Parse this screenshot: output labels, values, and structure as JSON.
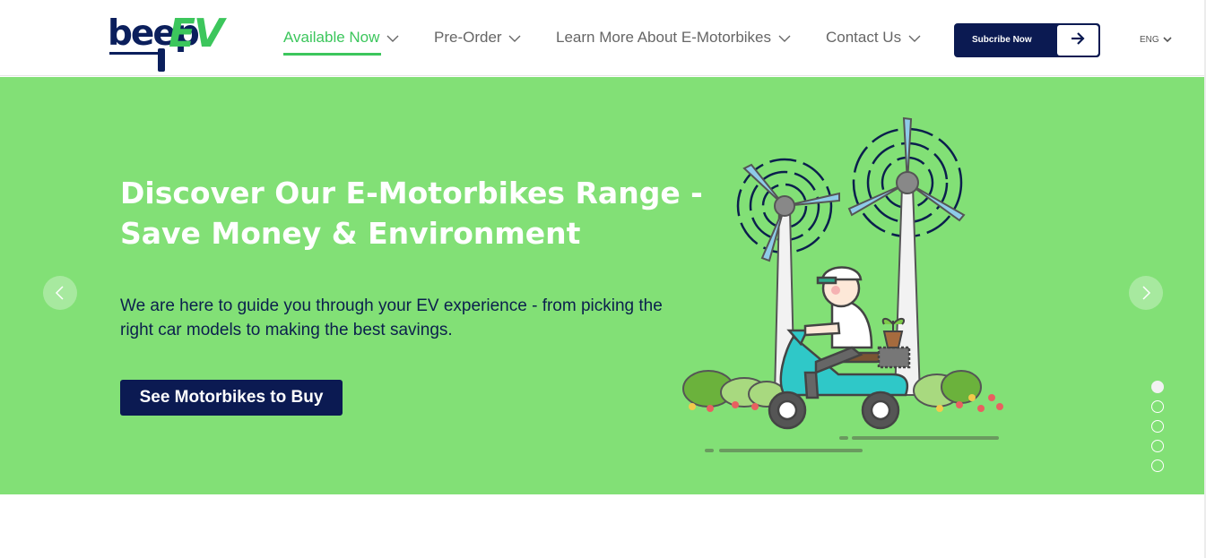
{
  "brand": {
    "logo_text_1": "beep",
    "logo_text_2": "EV"
  },
  "nav": {
    "items": [
      {
        "label": "Available Now",
        "active": true
      },
      {
        "label": "Pre-Order",
        "active": false
      },
      {
        "label": "Learn More About E-Motorbikes",
        "active": false
      },
      {
        "label": "Contact Us",
        "active": false
      }
    ]
  },
  "subscribe": {
    "label": "Subcribe Now",
    "icon": "arrow-right-icon"
  },
  "language": {
    "label": "ENG",
    "icon": "chevron-down-icon"
  },
  "hero": {
    "title": "Discover Our E-Motorbikes Range - Save Money & Environment",
    "subtitle": "We are here to guide you through your EV experience - from picking the right car models to making the best savings.",
    "cta_label": "See Motorbikes to Buy",
    "slide_count": 5,
    "active_slide": 1,
    "prev_icon": "chevron-left-icon",
    "next_icon": "chevron-right-icon"
  },
  "colors": {
    "brand_navy": "#0b1a52",
    "brand_green": "#3cc65c",
    "hero_bg": "#82e076"
  }
}
